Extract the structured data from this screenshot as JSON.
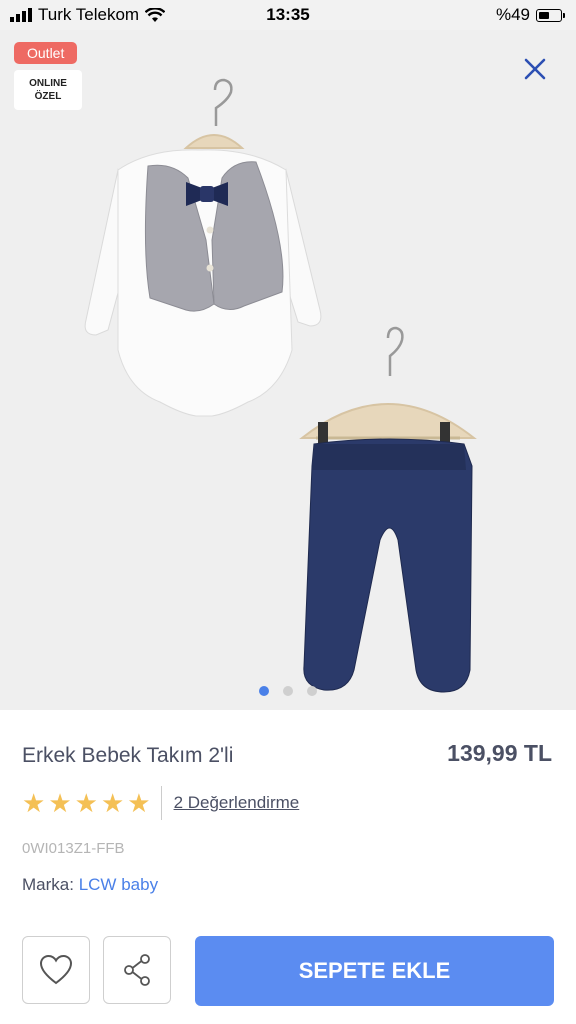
{
  "status_bar": {
    "carrier": "Turk Telekom",
    "time": "13:35",
    "battery": "%49",
    "battery_level": 0.49
  },
  "image": {
    "outlet_badge": "Outlet",
    "online_badge_line1": "ONLINE",
    "online_badge_line2": "ÖZEL",
    "close_icon": "close-icon",
    "pager": {
      "count": 3,
      "active_index": 0
    }
  },
  "product": {
    "title": "Erkek Bebek Takım 2'li",
    "price": "139,99 TL",
    "rating": 5,
    "reviews_label": "2 Değerlendirme",
    "sku": "0WI013Z1-FFB",
    "brand_label": "Marka:",
    "brand_name": "LCW baby"
  },
  "actions": {
    "favorite_icon": "heart-icon",
    "share_icon": "share-icon",
    "add_to_cart": "SEPETE EKLE"
  },
  "colors": {
    "accent": "#5b8cf1",
    "badge": "#ee6a63",
    "star": "#f4c055",
    "text": "#4b5064"
  }
}
